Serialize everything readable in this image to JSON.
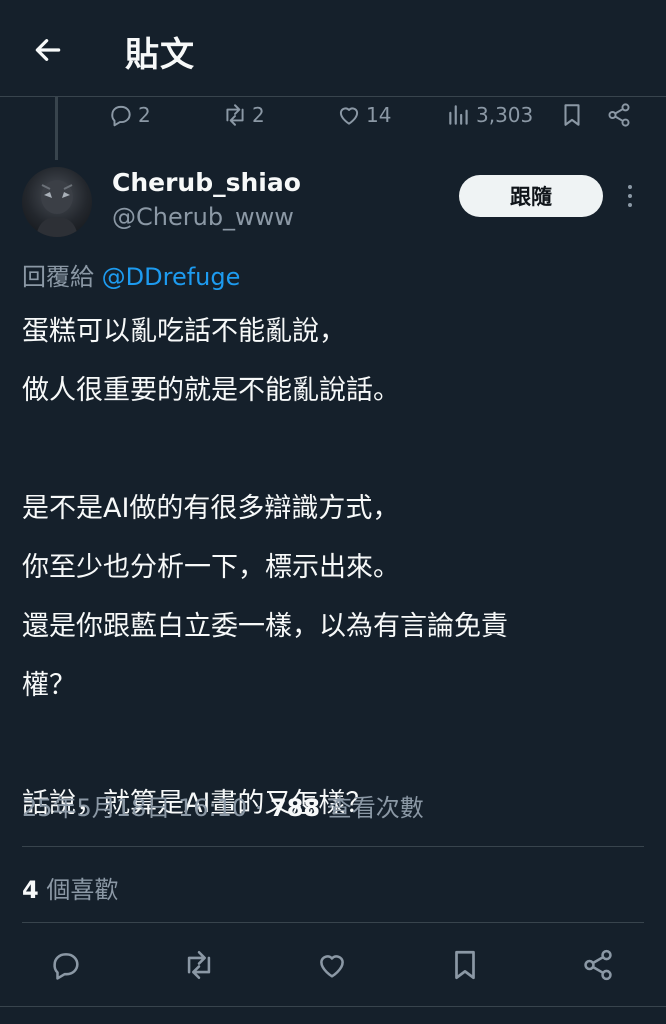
{
  "header": {
    "title": "貼文"
  },
  "prev_tweet_actions": {
    "replies": "2",
    "retweets": "2",
    "likes": "14",
    "views": "3,303"
  },
  "author": {
    "display_name": "Cherub_shiao",
    "handle": "@Cherub_www"
  },
  "follow_label": "跟隨",
  "reply_to": {
    "prefix": "回覆給",
    "mention": "@DDrefuge"
  },
  "tweet": {
    "lines": [
      "蛋糕可以亂吃話不能亂說，",
      "做人很重要的就是不能亂說話。",
      "",
      "是不是AI做的有很多辯識方式，",
      "你至少也分析一下，標示出來。",
      "還是你跟藍白立委一樣，以為有言論免責",
      "權？",
      "",
      "話說，就算是AI畫的又怎樣？"
    ]
  },
  "meta": {
    "timestamp": "25年5月18日 16:10",
    "separator": " · ",
    "views_count": "788",
    "views_label": " 查看次數"
  },
  "likes": {
    "count": "4",
    "label": " 個喜歡"
  },
  "colors": {
    "background": "#15202b",
    "text": "#f7f9f9",
    "muted": "#8b98a5",
    "link": "#1d9bf0",
    "border": "#38444d"
  },
  "icons": [
    "back-arrow-icon",
    "reply-icon",
    "retweet-icon",
    "like-icon",
    "views-icon",
    "bookmark-icon",
    "share-icon",
    "more-icon"
  ]
}
